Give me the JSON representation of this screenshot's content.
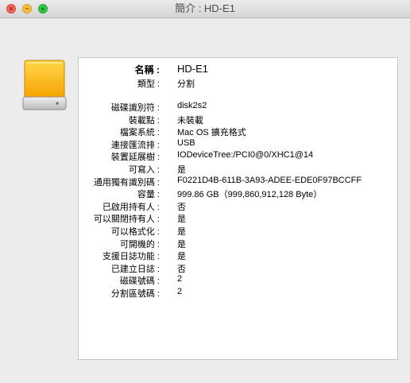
{
  "window": {
    "title": "簡介 : HD-E1",
    "close_glyph": "×",
    "minimize_glyph": "−",
    "zoom_glyph": "+"
  },
  "icon": "external-drive-icon",
  "info": {
    "name": {
      "label": "名稱 :",
      "value": "HD-E1"
    },
    "type": {
      "label": "類型 :",
      "value": "分割"
    },
    "rows": [
      {
        "label": "磁碟識別符 :",
        "value": "disk2s2"
      },
      {
        "label": "裝載點 :",
        "value": "未裝載"
      },
      {
        "label": "檔案系統 :",
        "value": "Mac OS 擴充格式"
      },
      {
        "label": "連接匯流排 :",
        "value": "USB"
      },
      {
        "label": "裝置延展樹 :",
        "value": "IODeviceTree:/PCI0@0/XHC1@14"
      },
      {
        "label": "可寫入 :",
        "value": "是"
      },
      {
        "label": "通用獨有識別碼 :",
        "value": "F0221D4B-611B-3A93-ADEE-EDE0F97BCCFF"
      },
      {
        "label": "容量 :",
        "value": "999.86 GB（999,860,912,128 Byte）"
      },
      {
        "label": "已啟用持有人 :",
        "value": "否"
      },
      {
        "label": "可以關閉持有人 :",
        "value": "是"
      },
      {
        "label": "可以格式化 :",
        "value": "是"
      },
      {
        "label": "可開機的 :",
        "value": "是"
      },
      {
        "label": "支援日誌功能 :",
        "value": "是"
      },
      {
        "label": "已建立日誌 :",
        "value": "否"
      },
      {
        "label": "磁碟號碼 :",
        "value": "2"
      },
      {
        "label": "分割區號碼 :",
        "value": "2"
      }
    ]
  }
}
